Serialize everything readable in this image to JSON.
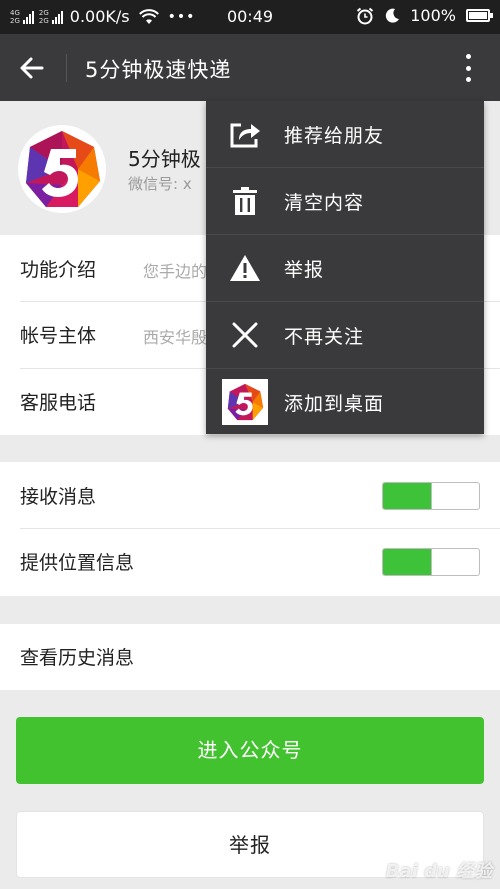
{
  "status_bar": {
    "network_top": "4G",
    "network_bottom": "2G",
    "network_top2": "2G",
    "network_bottom2": "2G",
    "speed": "0.00K/s",
    "overflow": "•••",
    "time": "00:49",
    "battery": "100%"
  },
  "header": {
    "title": "5分钟极速快递"
  },
  "profile": {
    "name": "5分钟极",
    "wechat_id": "微信号: x"
  },
  "info_rows": [
    {
      "label": "功能介绍",
      "value": "您手边的"
    },
    {
      "label": "帐号主体",
      "value": "西安华殷"
    },
    {
      "label": "客服电话",
      "value": ""
    }
  ],
  "toggles": [
    {
      "label": "接收消息",
      "on": true
    },
    {
      "label": "提供位置信息",
      "on": true
    }
  ],
  "history": {
    "label": "查看历史消息"
  },
  "buttons": {
    "enter": "进入公众号",
    "report": "举报"
  },
  "menu": {
    "items": [
      {
        "label": "推荐给朋友",
        "icon": "share-icon"
      },
      {
        "label": "清空内容",
        "icon": "trash-icon"
      },
      {
        "label": "举报",
        "icon": "warning-icon"
      },
      {
        "label": "不再关注",
        "icon": "close-icon"
      },
      {
        "label": "添加到桌面",
        "icon": "app-logo-icon"
      }
    ]
  },
  "watermark": "Bai du 经验",
  "colors": {
    "titlebar": "#3a3a3c",
    "accent_green": "#43c22f",
    "toggle_green": "#3ec23a",
    "background": "#ebebeb"
  }
}
